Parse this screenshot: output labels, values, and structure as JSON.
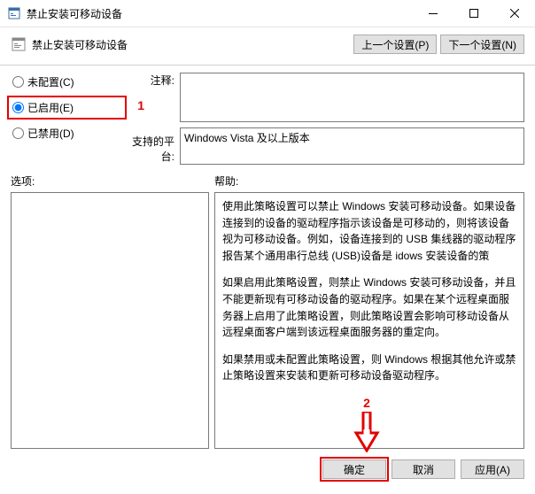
{
  "window": {
    "title": "禁止安装可移动设备"
  },
  "header": {
    "setting_name": "禁止安装可移动设备",
    "prev_btn": "上一个设置(P)",
    "next_btn": "下一个设置(N)"
  },
  "radios": {
    "not_configured": "未配置(C)",
    "enabled": "已启用(E)",
    "disabled": "已禁用(D)"
  },
  "labels": {
    "comment": "注释:",
    "platform": "支持的平台:",
    "options": "选项:",
    "help": "帮助:"
  },
  "fields": {
    "comment_value": "",
    "platform_value": "Windows Vista 及以上版本"
  },
  "help": {
    "p1": "使用此策略设置可以禁止 Windows 安装可移动设备。如果设备连接到的设备的驱动程序指示该设备是可移动的，则将该设备视为可移动设备。例如，设备连接到的 USB 集线器的驱动程序报告某个通用串行总线 (USB)设备是                                                                idows 安装设备的策",
    "p2": "如果启用此策略设置，则禁止 Windows 安装可移动设备，并且不能更新现有可移动设备的驱动程序。如果在某个远程桌面服务器上启用了此策略设置，则此策略设置会影响可移动设备从远程桌面客户端到该远程桌面服务器的重定向。",
    "p3": "如果禁用或未配置此策略设置，则 Windows 根据其他允许或禁止策略设置来安装和更新可移动设备驱动程序。"
  },
  "annotations": {
    "one": "1",
    "two": "2"
  },
  "buttons": {
    "ok": "确定",
    "cancel": "取消",
    "apply": "应用(A)"
  }
}
